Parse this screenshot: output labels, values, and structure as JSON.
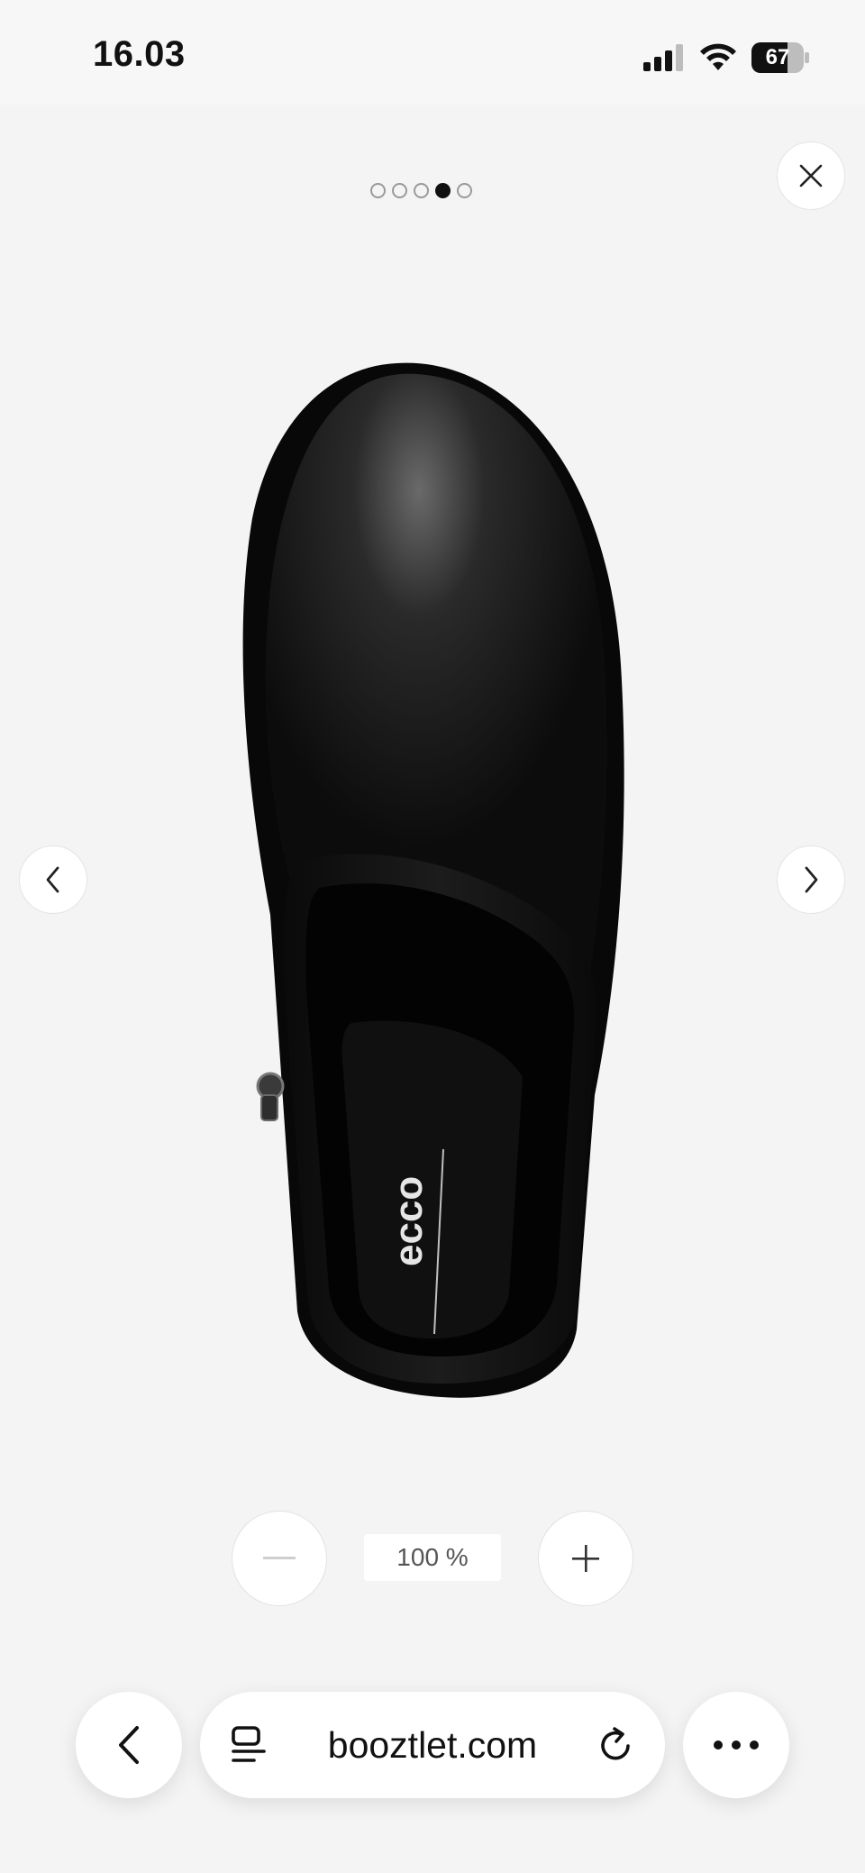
{
  "status_bar": {
    "time": "16.03",
    "battery": "67",
    "icons": [
      "cellular-signal-icon",
      "wifi-icon",
      "battery-icon"
    ]
  },
  "gallery": {
    "image_count": 5,
    "active_index": 4,
    "image_description_icon": "ankle-boot-photo",
    "brand_text_on_insole": "ecco"
  },
  "controls": {
    "close_icon": "close-icon",
    "prev_icon": "chevron-left-icon",
    "next_icon": "chevron-right-icon"
  },
  "zoom": {
    "level": "100 %",
    "zoom_out_icon": "minus-icon",
    "zoom_in_icon": "plus-icon"
  },
  "browser": {
    "url": "booztlet.com",
    "back_icon": "chevron-left-icon",
    "tabs_icon": "page-menu-icon",
    "reload_icon": "reload-icon",
    "more_icon": "more-dots-icon"
  },
  "colors": {
    "background": "#f4f4f4",
    "active_dot": "#111111"
  }
}
